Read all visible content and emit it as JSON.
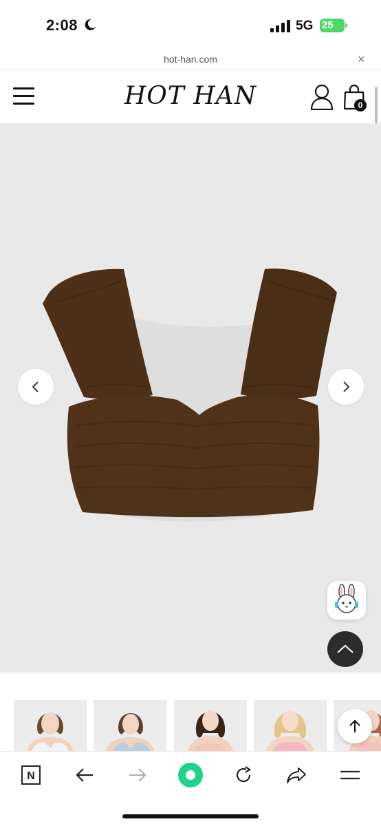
{
  "status_bar": {
    "time": "2:08",
    "network": "5G",
    "battery": "25"
  },
  "url_bar": {
    "url": "hot-han.com",
    "close_glyph": "×"
  },
  "header": {
    "logo": "HOT HAN",
    "cart_count": "0",
    "icons": [
      "hamburger-menu-icon",
      "user-icon",
      "shopping-bag-icon"
    ]
  },
  "hero": {
    "product_color": "#4d3017",
    "background_color": "#e9e9e9",
    "prev_icon": "chevron-left-icon",
    "next_icon": "chevron-right-icon",
    "chat_icon": "bunny-chat-icon",
    "top_icon": "chevron-up-icon"
  },
  "thumbnails": [
    {
      "top_color": "#f0f0f0"
    },
    {
      "top_color": "#b9cfe0"
    },
    {
      "top_color": "#f1c8b4"
    },
    {
      "top_color": "#f4b8c0"
    },
    {
      "top_color": "#f2c2bd"
    }
  ],
  "toolbar": {
    "icons": [
      "naver-n-icon",
      "back-arrow-icon",
      "forward-arrow-icon",
      "green-dot-icon",
      "refresh-icon",
      "share-icon",
      "menu-lines-icon"
    ],
    "naver_letter": "N",
    "accent_color": "#1ed38a"
  }
}
